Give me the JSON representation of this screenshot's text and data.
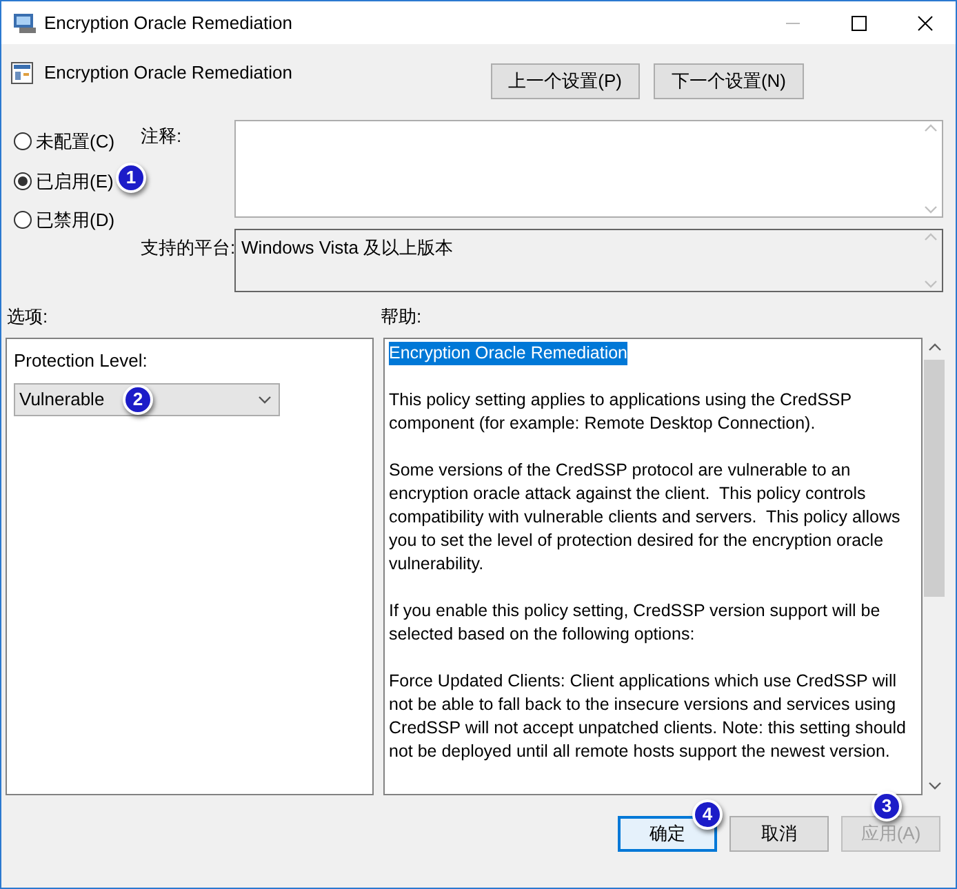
{
  "window": {
    "title": "Encryption Oracle Remediation"
  },
  "header": {
    "title": "Encryption Oracle Remediation",
    "buttons": [
      "上一个设置(P)",
      "下一个设置(N)"
    ]
  },
  "states": [
    {
      "label": "未配置(C)",
      "selected": false
    },
    {
      "label": "已启用(E)",
      "selected": true,
      "callout": "1"
    },
    {
      "label": "已禁用(D)",
      "selected": false
    }
  ],
  "comment": {
    "label": "注释:"
  },
  "platform": {
    "label": "支持的平台:",
    "value": "Windows Vista 及以上版本"
  },
  "options": {
    "label": "选项:",
    "field_label": "Protection Level:",
    "dropdown": {
      "value": "Vulnerable",
      "callout": "2"
    }
  },
  "help": {
    "label": "帮助:",
    "title": "Encryption Oracle Remediation",
    "paragraphs": [
      "This policy setting applies to applications using the CredSSP component (for example: Remote Desktop Connection).",
      "Some versions of the CredSSP protocol are vulnerable to an encryption oracle attack against the client.  This policy controls compatibility with vulnerable clients and servers.  This policy allows you to set the level of protection desired for the encryption oracle vulnerability.",
      "If you enable this policy setting, CredSSP version support will be selected based on the following options:",
      "Force Updated Clients: Client applications which use CredSSP will not be able to fall back to the insecure versions and services using CredSSP will not accept unpatched clients. Note: this setting should not be deployed until all remote hosts support the newest version."
    ]
  },
  "footer": [
    {
      "label": "确定",
      "kind": "default",
      "disabled": false,
      "callout": "4"
    },
    {
      "label": "取消",
      "kind": "normal",
      "disabled": false
    },
    {
      "label": "应用(A)",
      "kind": "normal",
      "disabled": true,
      "callout": "3"
    }
  ]
}
